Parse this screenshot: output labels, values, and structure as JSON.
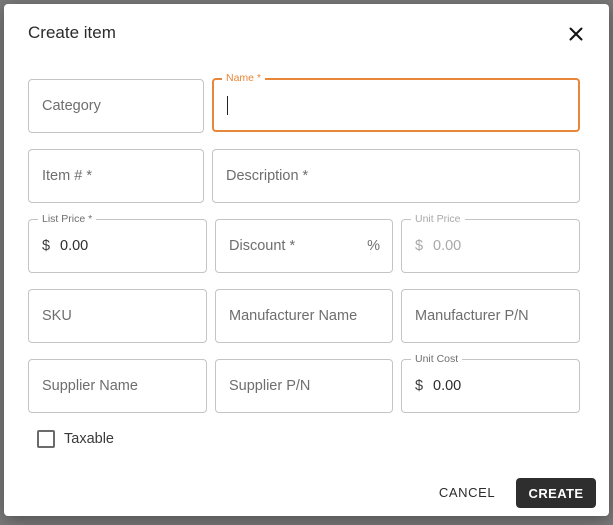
{
  "dialog": {
    "title": "Create item",
    "close_icon": "close-icon"
  },
  "fields": {
    "category": {
      "placeholder": "Category"
    },
    "name": {
      "label": "Name *",
      "value": ""
    },
    "item_number": {
      "placeholder": "Item # *"
    },
    "description": {
      "placeholder": "Description *"
    },
    "list_price": {
      "label": "List Price *",
      "prefix": "$",
      "value": "0.00"
    },
    "discount": {
      "placeholder": "Discount *",
      "suffix": "%"
    },
    "unit_price": {
      "label": "Unit Price",
      "prefix": "$",
      "value": "0.00"
    },
    "sku": {
      "placeholder": "SKU"
    },
    "manufacturer_name": {
      "placeholder": "Manufacturer Name"
    },
    "manufacturer_pn": {
      "placeholder": "Manufacturer P/N"
    },
    "supplier_name": {
      "placeholder": "Supplier Name"
    },
    "supplier_pn": {
      "placeholder": "Supplier P/N"
    },
    "unit_cost": {
      "label": "Unit Cost",
      "prefix": "$",
      "value": "0.00"
    }
  },
  "taxable": {
    "label": "Taxable",
    "checked": false
  },
  "actions": {
    "cancel_label": "CANCEL",
    "create_label": "CREATE"
  },
  "colors": {
    "focus_accent": "#e8873a",
    "primary_button": "#2e2e2e"
  }
}
